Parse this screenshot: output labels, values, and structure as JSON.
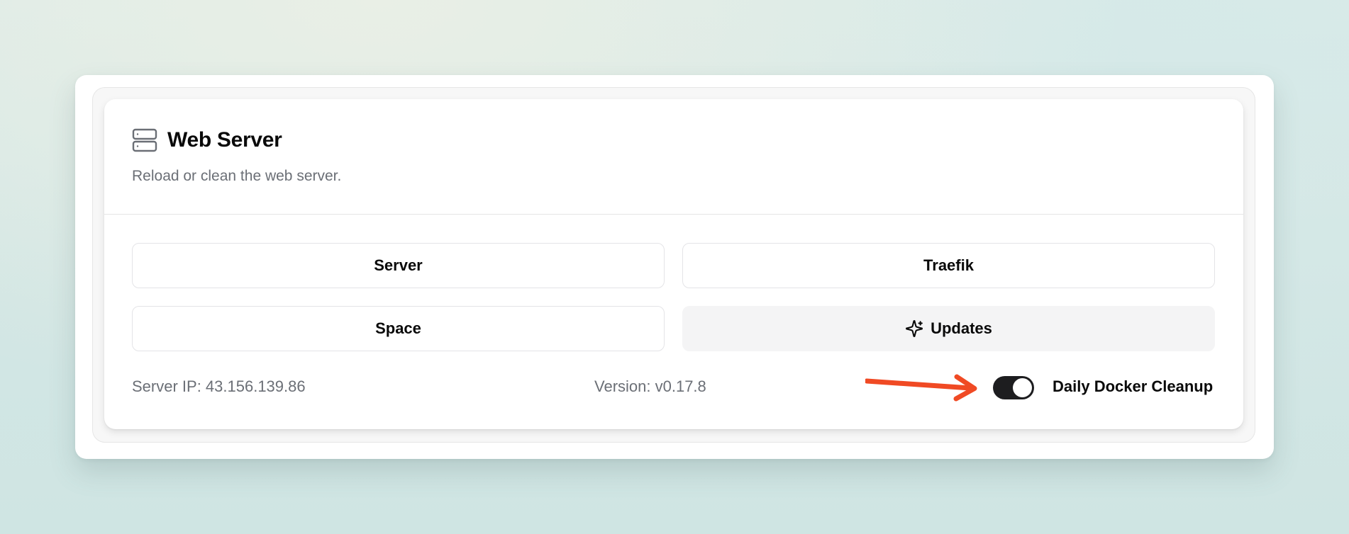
{
  "card": {
    "icon": "server-icon",
    "title": "Web Server",
    "description": "Reload or clean the web server."
  },
  "buttons": {
    "server": "Server",
    "traefik": "Traefik",
    "space": "Space",
    "updates": "Updates",
    "updates_icon": "sparkles-icon"
  },
  "footer": {
    "server_ip": "Server IP: 43.156.139.86",
    "version": "Version: v0.17.8",
    "toggle": {
      "label": "Daily Docker Cleanup",
      "checked": true
    }
  },
  "annotation": {
    "icon": "arrow-icon",
    "color": "#f04a24"
  }
}
